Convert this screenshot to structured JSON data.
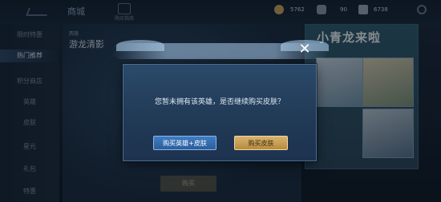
{
  "header": {
    "title": "商城",
    "guide_label": "购买指南",
    "currencies": [
      {
        "icon": "coin-icon",
        "value": "5762"
      },
      {
        "icon": "diamond-icon",
        "value": "90"
      },
      {
        "icon": "voucher-icon",
        "value": "6738"
      }
    ]
  },
  "sidebar": {
    "items": [
      {
        "label": "限时特惠"
      },
      {
        "label": "热门推荐"
      },
      {
        "label": "积分商店"
      },
      {
        "label": "英雄"
      },
      {
        "label": "皮肤"
      },
      {
        "label": "星元"
      },
      {
        "label": "礼包"
      },
      {
        "label": "特惠"
      }
    ]
  },
  "hero": {
    "tag": "西施",
    "name": "游龙清影",
    "buy_label": "购买"
  },
  "promo": {
    "title": "小青龙来啦"
  },
  "dialog": {
    "message": "您暂未拥有该英雄，是否继续购买皮肤？",
    "close_symbol": "✕",
    "buy_hero_skin_label": "购买英雄+皮肤",
    "buy_skin_label": "购买皮肤"
  },
  "colors": {
    "dialog_bg": "#213a56",
    "primary_button": "#2b5d9a",
    "gold_button": "#c79b4f"
  }
}
